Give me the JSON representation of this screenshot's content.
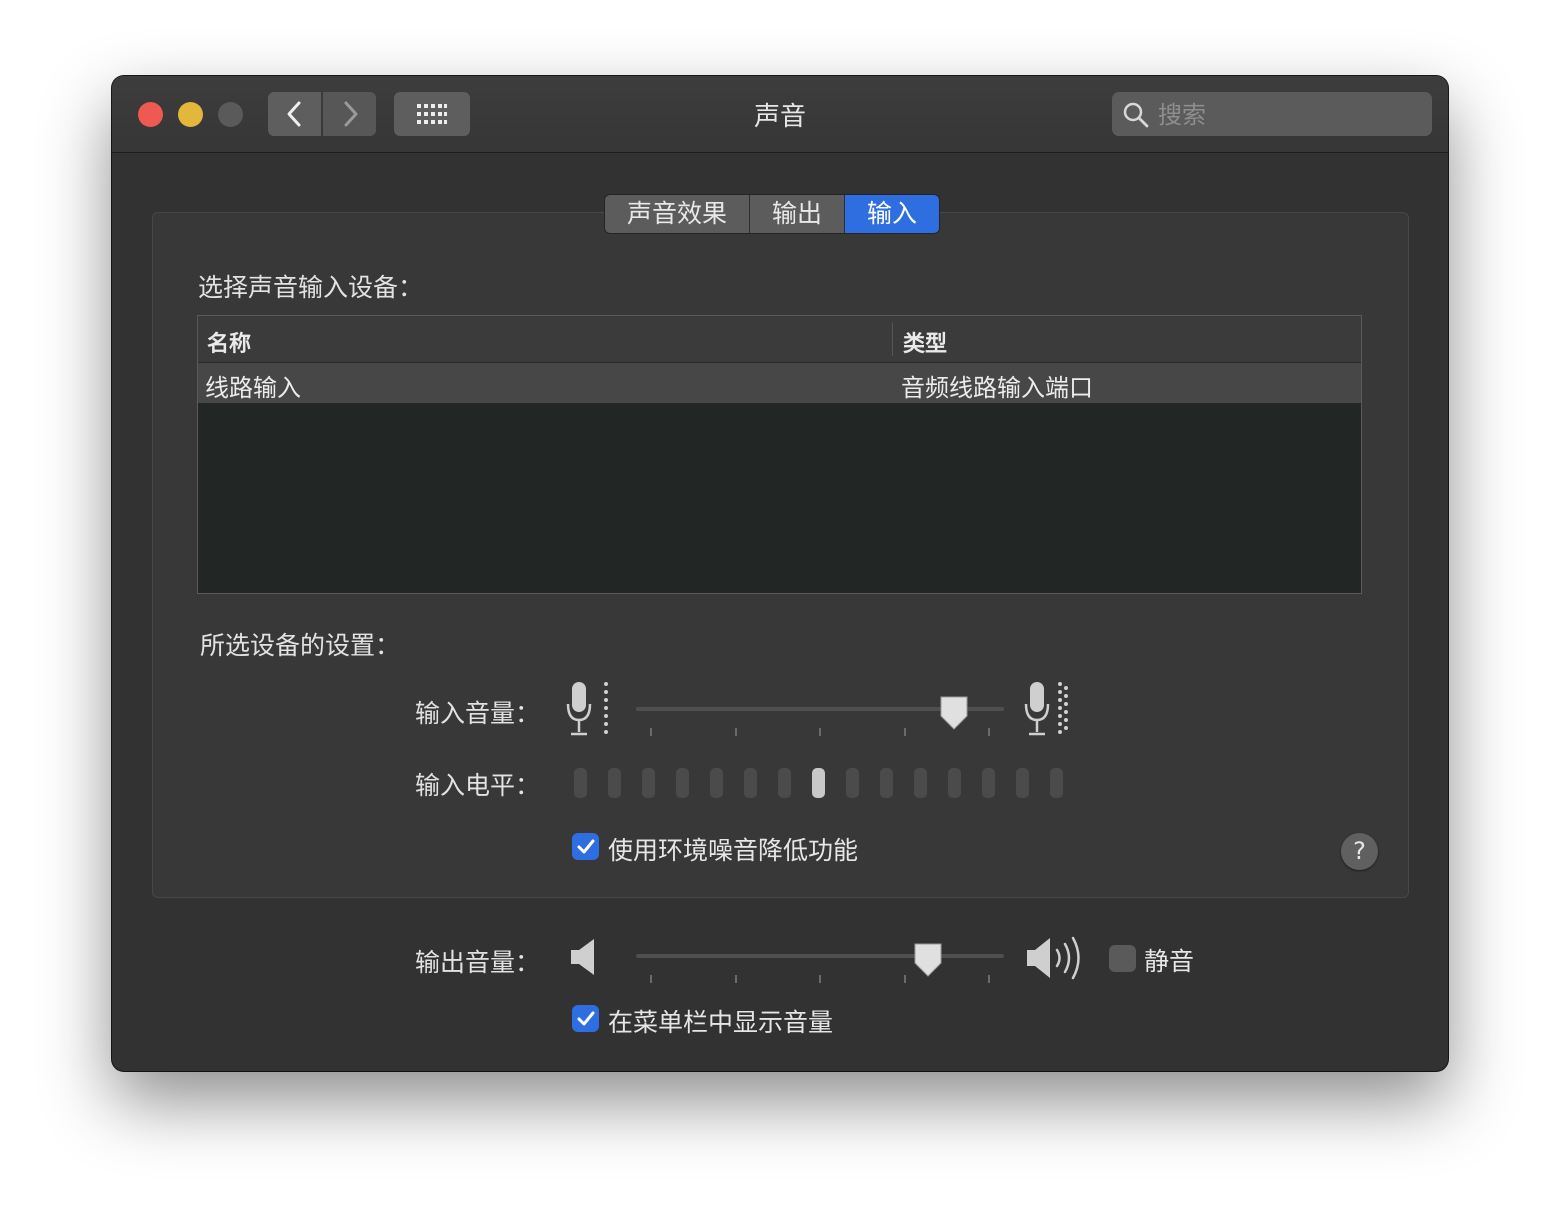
{
  "window": {
    "title": "声音"
  },
  "search": {
    "placeholder": "搜索"
  },
  "tabs": [
    {
      "label": "声音效果",
      "active": false
    },
    {
      "label": "输出",
      "active": false
    },
    {
      "label": "输入",
      "active": true
    }
  ],
  "input_section": {
    "device_heading": "选择声音输入设备：",
    "columns": [
      "名称",
      "类型"
    ],
    "rows": [
      {
        "name": "线路输入",
        "type": "音频线路输入端口"
      }
    ],
    "settings_heading": "所选设备的设置：",
    "input_volume_label": "输入音量：",
    "input_volume_level": 0.9,
    "input_level_label": "输入电平：",
    "input_level_segments": 15,
    "input_level_active_index": 7,
    "noise_reduction": {
      "label": "使用环境噪音降低功能",
      "checked": true
    },
    "help_label": "?"
  },
  "output_section": {
    "output_volume_label": "输出音量：",
    "output_volume_level": 0.82,
    "mute": {
      "label": "静音",
      "checked": false
    },
    "show_in_menubar": {
      "label": "在菜单栏中显示音量",
      "checked": true
    }
  },
  "colors": {
    "accent": "#2f6ee0",
    "close": "#ee5a52",
    "minimize": "#e3b73b"
  }
}
